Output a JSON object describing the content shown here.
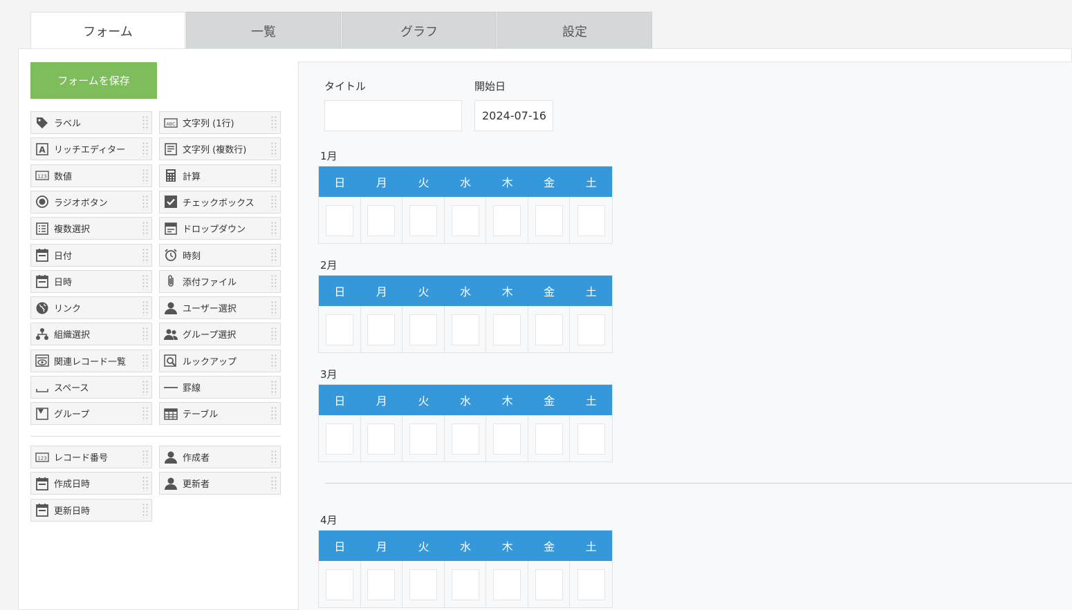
{
  "tabs": [
    {
      "label": "フォーム"
    },
    {
      "label": "一覧"
    },
    {
      "label": "グラフ"
    },
    {
      "label": "設定"
    }
  ],
  "save_button": "フォームを保存",
  "palette": {
    "fields": [
      {
        "label": "ラベル",
        "icon": "tag-icon"
      },
      {
        "label": "文字列 (1行)",
        "icon": "abc-text-icon"
      },
      {
        "label": "リッチエディター",
        "icon": "rich-editor-icon"
      },
      {
        "label": "文字列 (複数行)",
        "icon": "multiline-text-icon"
      },
      {
        "label": "数値",
        "icon": "number-123-icon"
      },
      {
        "label": "計算",
        "icon": "calculator-icon"
      },
      {
        "label": "ラジオボタン",
        "icon": "radio-icon"
      },
      {
        "label": "チェックボックス",
        "icon": "checkbox-icon"
      },
      {
        "label": "複数選択",
        "icon": "multi-select-icon"
      },
      {
        "label": "ドロップダウン",
        "icon": "dropdown-icon"
      },
      {
        "label": "日付",
        "icon": "calendar-icon"
      },
      {
        "label": "時刻",
        "icon": "alarm-clock-icon"
      },
      {
        "label": "日時",
        "icon": "calendar-icon"
      },
      {
        "label": "添付ファイル",
        "icon": "paperclip-icon"
      },
      {
        "label": "リンク",
        "icon": "globe-icon"
      },
      {
        "label": "ユーザー選択",
        "icon": "user-icon"
      },
      {
        "label": "組織選択",
        "icon": "org-chart-icon"
      },
      {
        "label": "グループ選択",
        "icon": "users-group-icon"
      },
      {
        "label": "関連レコード一覧",
        "icon": "eye-list-icon"
      },
      {
        "label": "ルックアップ",
        "icon": "lookup-icon"
      },
      {
        "label": "スペース",
        "icon": "space-icon"
      },
      {
        "label": "罫線",
        "icon": "horizontal-line-icon"
      },
      {
        "label": "グループ",
        "icon": "group-fold-icon"
      },
      {
        "label": "テーブル",
        "icon": "table-icon"
      }
    ],
    "system_fields": [
      {
        "label": "レコード番号",
        "icon": "number-123-icon"
      },
      {
        "label": "作成者",
        "icon": "user-icon"
      },
      {
        "label": "作成日時",
        "icon": "calendar-icon"
      },
      {
        "label": "更新者",
        "icon": "user-icon"
      },
      {
        "label": "更新日時",
        "icon": "calendar-icon"
      }
    ]
  },
  "form": {
    "title_label": "タイトル",
    "title_value": "",
    "start_date_label": "開始日",
    "start_date_value": "2024-07-16",
    "weekdays": [
      "日",
      "月",
      "火",
      "水",
      "木",
      "金",
      "土"
    ],
    "months": [
      {
        "label": "1月"
      },
      {
        "label": "2月"
      },
      {
        "label": "3月"
      },
      {
        "label": "4月"
      }
    ]
  },
  "colors": {
    "save_button": "#7dbd5c",
    "calendar_header": "#3498db",
    "tab_inactive": "#d4d8d8"
  }
}
